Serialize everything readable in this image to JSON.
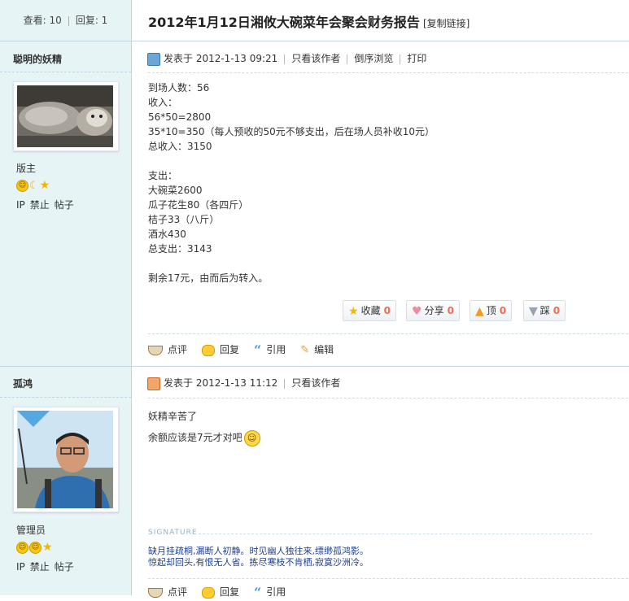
{
  "header": {
    "views_label": "查看: 10",
    "replies_label": "回复: 1",
    "title": "2012年1月12日湘攸大碗菜年会聚会财务报告",
    "copy_link": "[复制链接]"
  },
  "posts": [
    {
      "author": "聪明的妖精",
      "role": "版主",
      "links": [
        "IP",
        "禁止",
        "帖子"
      ],
      "meta": {
        "posted": "发表于 2012-1-13 09:21",
        "actions": [
          "只看该作者",
          "倒序浏览",
          "打印"
        ]
      },
      "body": [
        "到场人数：56",
        "收入：",
        "56*50=2800",
        "35*10=350（每人预收的50元不够支出，后在场人员补收10元）",
        "总收入：3150",
        "",
        "支出：",
        "大碗菜2600",
        "瓜子花生80（各四斤）",
        "桔子33（八斤）",
        "酒水430",
        "总支出：3143",
        "",
        "剩余17元，由而后为转入。"
      ],
      "votes": [
        {
          "label": "收藏",
          "count": "0",
          "icon": "star-icon"
        },
        {
          "label": "分享",
          "count": "0",
          "icon": "heart-icon"
        },
        {
          "label": "顶",
          "count": "0",
          "icon": "thumb-up-icon"
        },
        {
          "label": "踩",
          "count": "0",
          "icon": "thumb-down-icon"
        }
      ],
      "bar": [
        "点评",
        "回复",
        "引用",
        "编辑"
      ]
    },
    {
      "author": "孤鸿",
      "role": "管理员",
      "links": [
        "IP",
        "禁止",
        "帖子"
      ],
      "meta": {
        "posted": "发表于 2012-1-13 11:12",
        "actions": [
          "只看该作者"
        ]
      },
      "body": [
        "妖精辛苦了",
        "余额应该是7元才对吧"
      ],
      "signature_title": "SIGNATURE",
      "signature": [
        "缺月挂疏桐,漏断人初静。时见幽人独往来,缥缈孤鸿影。",
        "惊起却回头,有恨无人省。拣尽寒枝不肯栖,寂寞沙洲冷。"
      ],
      "bar": [
        "点评",
        "回复",
        "引用"
      ]
    }
  ],
  "colors": {
    "sidebar_bg": "#e6f4f6",
    "border": "#c2d5e3",
    "signature_text": "#1f3f8f",
    "vote_count": "#f26c4f"
  }
}
